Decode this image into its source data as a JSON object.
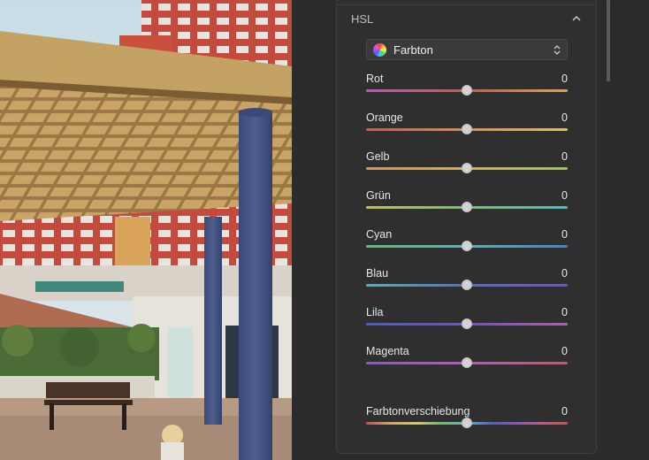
{
  "panel": {
    "section_title": "HSL",
    "mode_dropdown": {
      "value": "Farbton"
    }
  },
  "sliders": [
    {
      "label": "Rot",
      "value": "0",
      "level": 0.5,
      "gradient": [
        "#c84fc8",
        "#e0504a",
        "#e8a23a"
      ]
    },
    {
      "label": "Orange",
      "value": "0",
      "level": 0.5,
      "gradient": [
        "#e0504a",
        "#e88a3a",
        "#e8c03a"
      ]
    },
    {
      "label": "Gelb",
      "value": "0",
      "level": 0.5,
      "gradient": [
        "#e89040",
        "#d4b040",
        "#9ccc3c"
      ]
    },
    {
      "label": "Grün",
      "value": "0",
      "level": 0.5,
      "gradient": [
        "#c8c040",
        "#6cc860",
        "#3cc4cc"
      ]
    },
    {
      "label": "Cyan",
      "value": "0",
      "level": 0.5,
      "gradient": [
        "#58c070",
        "#40bcc0",
        "#3c84e0"
      ]
    },
    {
      "label": "Blau",
      "value": "0",
      "level": 0.5,
      "gradient": [
        "#40b8c0",
        "#4a70e0",
        "#7a48e0"
      ]
    },
    {
      "label": "Lila",
      "value": "0",
      "level": 0.5,
      "gradient": [
        "#4458e0",
        "#7848e0",
        "#c050c8"
      ]
    },
    {
      "label": "Magenta",
      "value": "0",
      "level": 0.5,
      "gradient": [
        "#9050e0",
        "#c050c8",
        "#e04a6a"
      ]
    }
  ],
  "hue_shift": {
    "label": "Farbtonverschiebung",
    "value": "0",
    "level": 0.5,
    "gradient": [
      "#e04848",
      "#e8a040",
      "#d8d040",
      "#58c860",
      "#40c0d0",
      "#4860e0",
      "#9848e0",
      "#e04890",
      "#e04848"
    ]
  },
  "colors": {
    "panel_bg": "#2b2b2b",
    "card_bg": "#2f2f2f",
    "thumb": "#d2d2d2"
  }
}
